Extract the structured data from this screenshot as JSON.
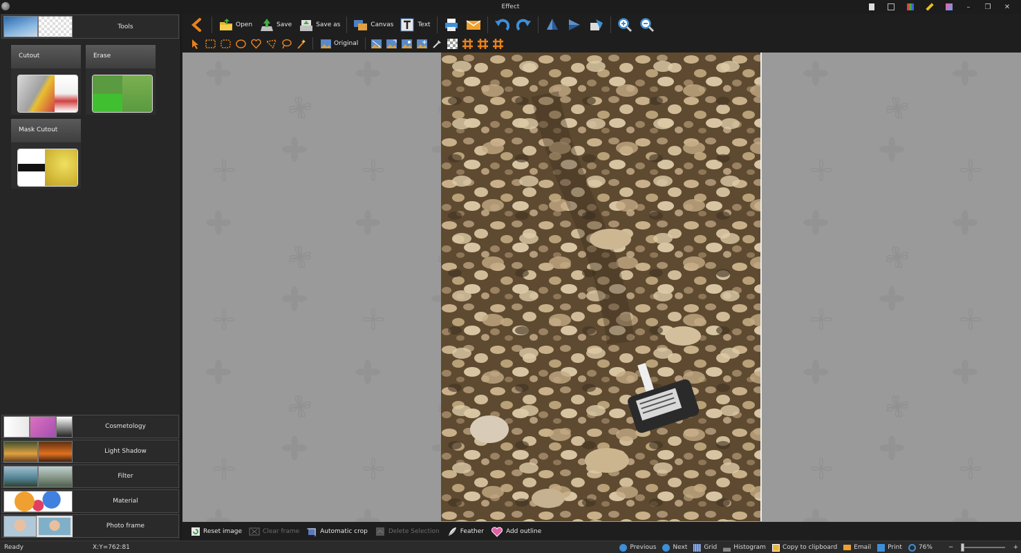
{
  "window": {
    "title": "Effect"
  },
  "sidebar": {
    "tools_label": "Tools",
    "cards": [
      {
        "label": "Cutout"
      },
      {
        "label": "Erase"
      },
      {
        "label": "Mask Cutout"
      }
    ],
    "categories": [
      {
        "label": "Cosmetology"
      },
      {
        "label": "Light Shadow"
      },
      {
        "label": "Filter"
      },
      {
        "label": "Material"
      },
      {
        "label": "Photo frame"
      }
    ]
  },
  "toolbar": {
    "open": "Open",
    "save": "Save",
    "save_as": "Save as",
    "canvas": "Canvas",
    "text": "Text",
    "original": "Original"
  },
  "bottom_actions": {
    "reset_image": "Reset image",
    "clear_frame": "Clear frame",
    "automatic_crop": "Automatic crop",
    "delete_selection": "Delete Selection",
    "feather": "Feather",
    "add_outline": "Add outline"
  },
  "status": {
    "state": "Ready",
    "coords": "X:Y=762:81",
    "previous": "Previous",
    "next": "Next",
    "grid": "Grid",
    "histogram": "Histogram",
    "copy_clipboard": "Copy to clipboard",
    "email": "Email",
    "print": "Print",
    "zoom": "76%",
    "zoom_minus": "−",
    "zoom_plus": "+"
  },
  "colors": {
    "accent_orange": "#e8821e",
    "accent_blue": "#3d8fd8",
    "canvas_bg": "#9a9a9a"
  }
}
